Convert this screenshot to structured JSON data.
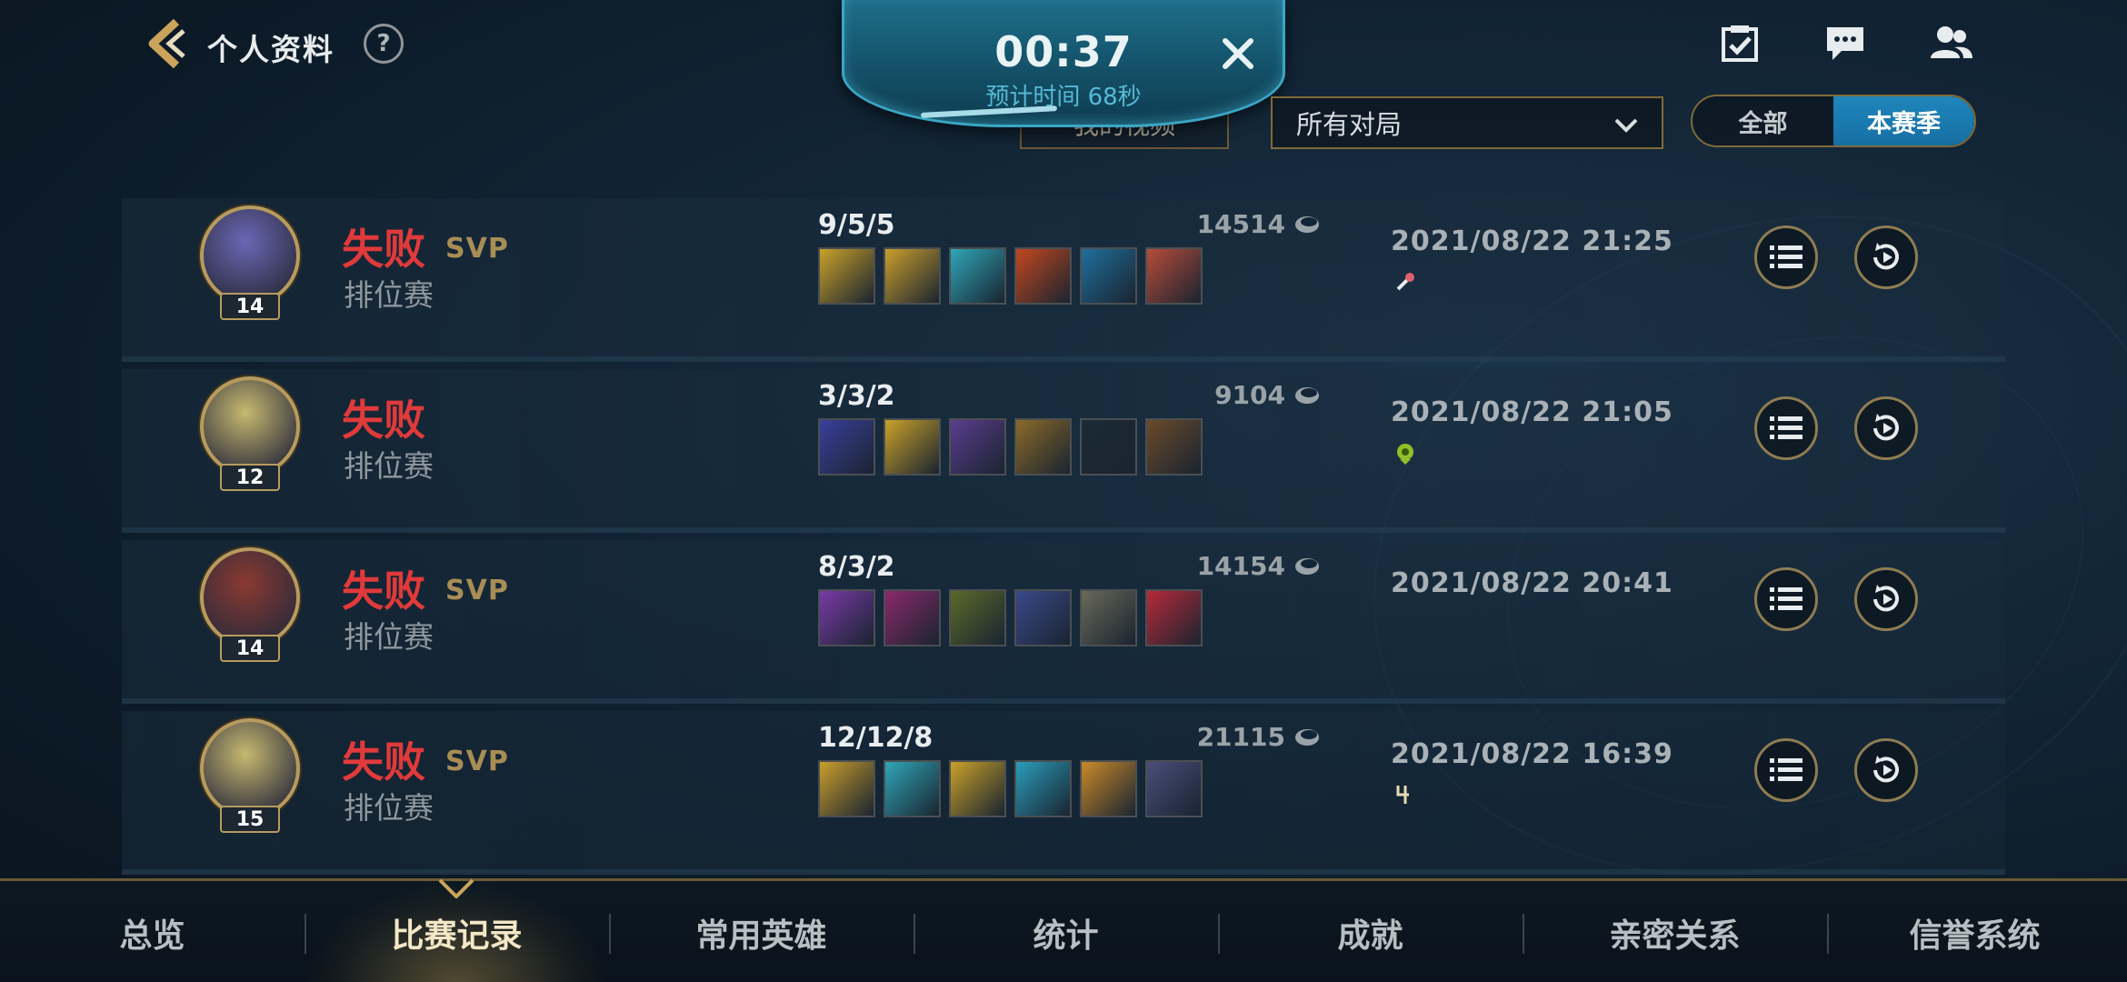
{
  "header": {
    "title": "个人资料",
    "help": "?"
  },
  "queue": {
    "timer": "00:37",
    "estimate": "预计时间 68秒",
    "progress": 0.3
  },
  "video_button": "我的视频",
  "filter": {
    "selected": "所有对局"
  },
  "scope": {
    "options": [
      "全部",
      "本赛季"
    ],
    "selected": "本赛季"
  },
  "top_icons": [
    "task-checklist-icon",
    "chat-icon",
    "friends-icon"
  ],
  "matches": [
    {
      "result": "失败",
      "svp": "SVP",
      "mode": "排位赛",
      "level": "14",
      "kda": "9/5/5",
      "gold": "14514",
      "datetime": "2021/08/22 21:25",
      "tag": "sword-tag-icon",
      "avatar_color": "#6a68b6",
      "items": [
        "#c9a12a",
        "#c99e2c",
        "#2fa6b8",
        "#c2471f",
        "#1f6f9c",
        "#b64b3a"
      ]
    },
    {
      "result": "失败",
      "svp": "",
      "mode": "排位赛",
      "level": "12",
      "kda": "3/3/2",
      "gold": "9104",
      "datetime": "2021/08/22 21:05",
      "tag": "green-medal-icon",
      "avatar_color": "#c7b970",
      "items": [
        "#3a3f9c",
        "#c9a12a",
        "#5b3d8e",
        "#8a6a2a",
        "#1b2a36",
        "#6b4a2a"
      ]
    },
    {
      "result": "失败",
      "svp": "SVP",
      "mode": "排位赛",
      "level": "14",
      "kda": "8/3/2",
      "gold": "14154",
      "datetime": "2021/08/22 20:41",
      "tag": "",
      "avatar_color": "#8a3a32",
      "items": [
        "#7a3aa6",
        "#8a2a6a",
        "#5a6a2a",
        "#3a4a8a",
        "#6a6a5a",
        "#b62a3a"
      ]
    },
    {
      "result": "失败",
      "svp": "SVP",
      "mode": "排位赛",
      "level": "15",
      "kda": "12/12/8",
      "gold": "21115",
      "datetime": "2021/08/22 16:39",
      "tag": "rune-4-icon",
      "avatar_color": "#c7b970",
      "items": [
        "#c99e2c",
        "#2fa6b8",
        "#c9a12a",
        "#2a9cba",
        "#c98a2a",
        "#4a4e7a"
      ]
    }
  ],
  "nav": {
    "items": [
      "总览",
      "比赛记录",
      "常用英雄",
      "统计",
      "成就",
      "亲密关系",
      "信誉系统"
    ],
    "active": "比赛记录"
  }
}
